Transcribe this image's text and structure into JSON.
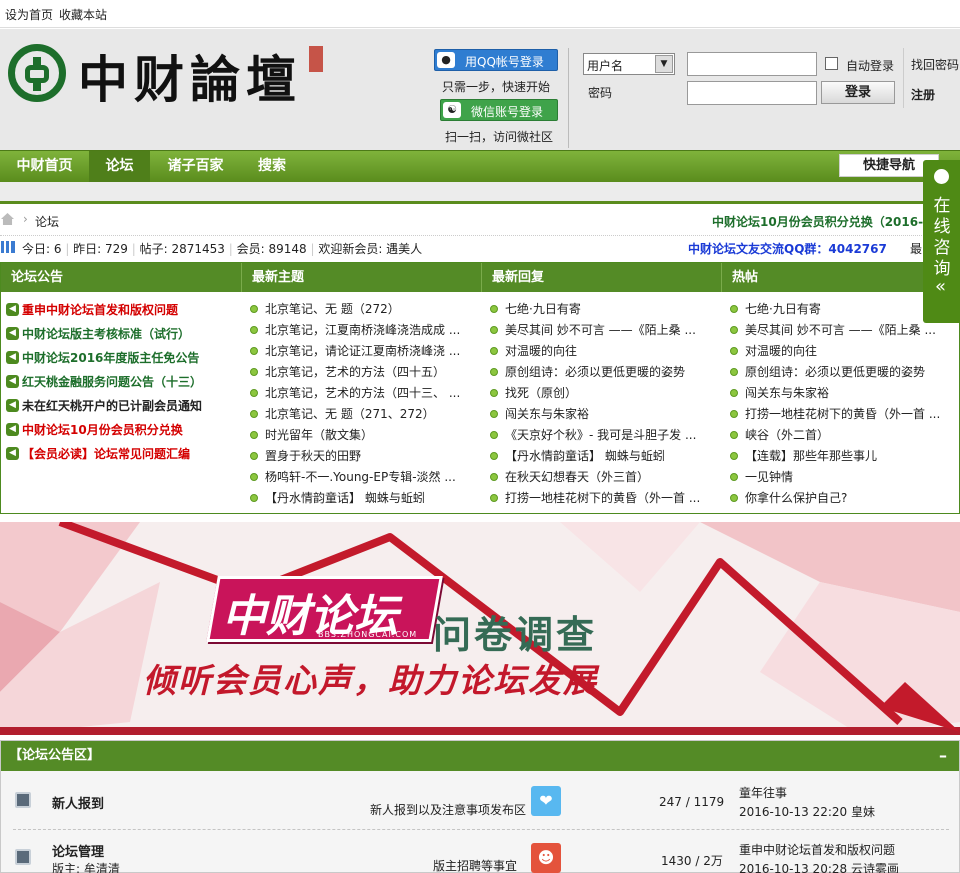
{
  "topbar": {
    "set_home": "设为首页",
    "bookmark": "收藏本站"
  },
  "header": {
    "logo_text": "中财論壇",
    "qq_login": "用QQ帐号登录",
    "qq_hint": "只需一步，快速开始",
    "wechat_login": "微信账号登录",
    "wechat_hint": "扫一扫，访问微社区",
    "username_select": "用户名",
    "password_label": "密码",
    "auto_login": "自动登录",
    "login_button": "登录",
    "forgot_password": "找回密码",
    "register": "注册"
  },
  "nav": {
    "items": [
      "中财首页",
      "论坛",
      "诸子百家",
      "搜索"
    ],
    "quick_nav": "快捷导航"
  },
  "side_consult": {
    "label": "在线咨询",
    "arrow": "«"
  },
  "breadcrumb": {
    "current": "论坛",
    "marquee": "中财论坛10月份会员积分兑换（2016-"
  },
  "stats": {
    "today_label": "今日: ",
    "today": "6",
    "yesterday_label": "昨日: ",
    "yesterday": "729",
    "posts_label": "帖子: ",
    "posts": "2871453",
    "members_label": "会员: ",
    "members": "89148",
    "welcome": "欢迎新会员: ",
    "new_member": "遇美人",
    "qq_group": "中财论坛文友交流QQ群：4042767",
    "tail": "最"
  },
  "panels": {
    "headers": [
      "论坛公告",
      "最新主题",
      "最新回复",
      "热帖"
    ],
    "announcements": [
      {
        "text": "重申中财论坛首发和版权问题",
        "color": "#d40000"
      },
      {
        "text": "中财论坛版主考核标准（试行）",
        "color": "#1d6e2b"
      },
      {
        "text": "中财论坛2016年度版主任免公告",
        "color": "#1d6e2b"
      },
      {
        "text": "红天桃金融服务问题公告（十三）",
        "color": "#1d6e2b"
      },
      {
        "text": "未在红天桃开户的已计副会员通知",
        "color": "#222222"
      },
      {
        "text": "中财论坛10月份会员积分兑换",
        "color": "#d40000"
      },
      {
        "text": "【会员必读】论坛常见问题汇编",
        "color": "#d40000"
      }
    ],
    "latest_topics": [
      "北京笔记、无  题（272）",
      "北京笔记，江夏南桥浇峰浇浩成成 ...",
      "北京笔记，请论证江夏南桥浇峰浇 ...",
      "北京笔记，艺术的方法（四十五）",
      "北京笔记，艺术的方法（四十三、 ...",
      "北京笔记、无  题（271、272）",
      "时光留年（散文集）",
      "置身于秋天的田野",
      "杨鸣轩-不一.Young-EP专辑-淡然 ...",
      "【丹水情韵童话】 蜘蛛与蚯蚓"
    ],
    "latest_replies": [
      "七绝·九日有寄",
      "美尽其间  妙不可言 ——《陌上桑 ...",
      "对温暖的向往",
      "原创组诗：必须以更低更暖的姿势",
      "找死（原创）",
      "闯关东与朱家裕",
      "《天京好个秋》- 我可是斗胆子发 ...",
      "【丹水情韵童话】 蜘蛛与蚯蚓",
      "在秋天幻想春天（外三首）",
      "打捞一地桂花树下的黄昏（外一首 ..."
    ],
    "hot_posts": [
      "七绝·九日有寄",
      "美尽其间  妙不可言 ——《陌上桑 ...",
      "对温暖的向往",
      "原创组诗：必须以更低更暖的姿势",
      "闯关东与朱家裕",
      "打捞一地桂花树下的黄昏（外一首 ...",
      "峡谷（外二首）",
      "【连载】那些年那些事儿",
      "一见钟情",
      "你拿什么保护自己?"
    ]
  },
  "banner": {
    "brand": "中财论坛",
    "url": "BBS.ZHONGCAI.COM",
    "title": "问卷调查",
    "slogan": "倾听会员心声，助力论坛发展"
  },
  "section": {
    "title": "【论坛公告区】",
    "collapse": "–",
    "forums": [
      {
        "name": "新人报到",
        "moderator": "",
        "desc": "新人报到以及注意事项发布区",
        "counts": "247 / 1179",
        "last_title": "童年往事",
        "last_info": "2016-10-13 22:20 皇妹"
      },
      {
        "name": "论坛管理",
        "moderator": "版主: 牟清清",
        "desc": "版主招聘等事宜",
        "counts": "1430 / 2万",
        "last_title": "重申中财论坛首发和版权问题",
        "last_info": "2016-10-13 20:28 云诗雾画"
      }
    ]
  },
  "colors": {
    "nav_green": "#5a8c1d",
    "panel_green": "#548b26",
    "alert_red": "#d40000",
    "link_green": "#1d6e2b",
    "qq_blue": "#1a3ad6"
  }
}
